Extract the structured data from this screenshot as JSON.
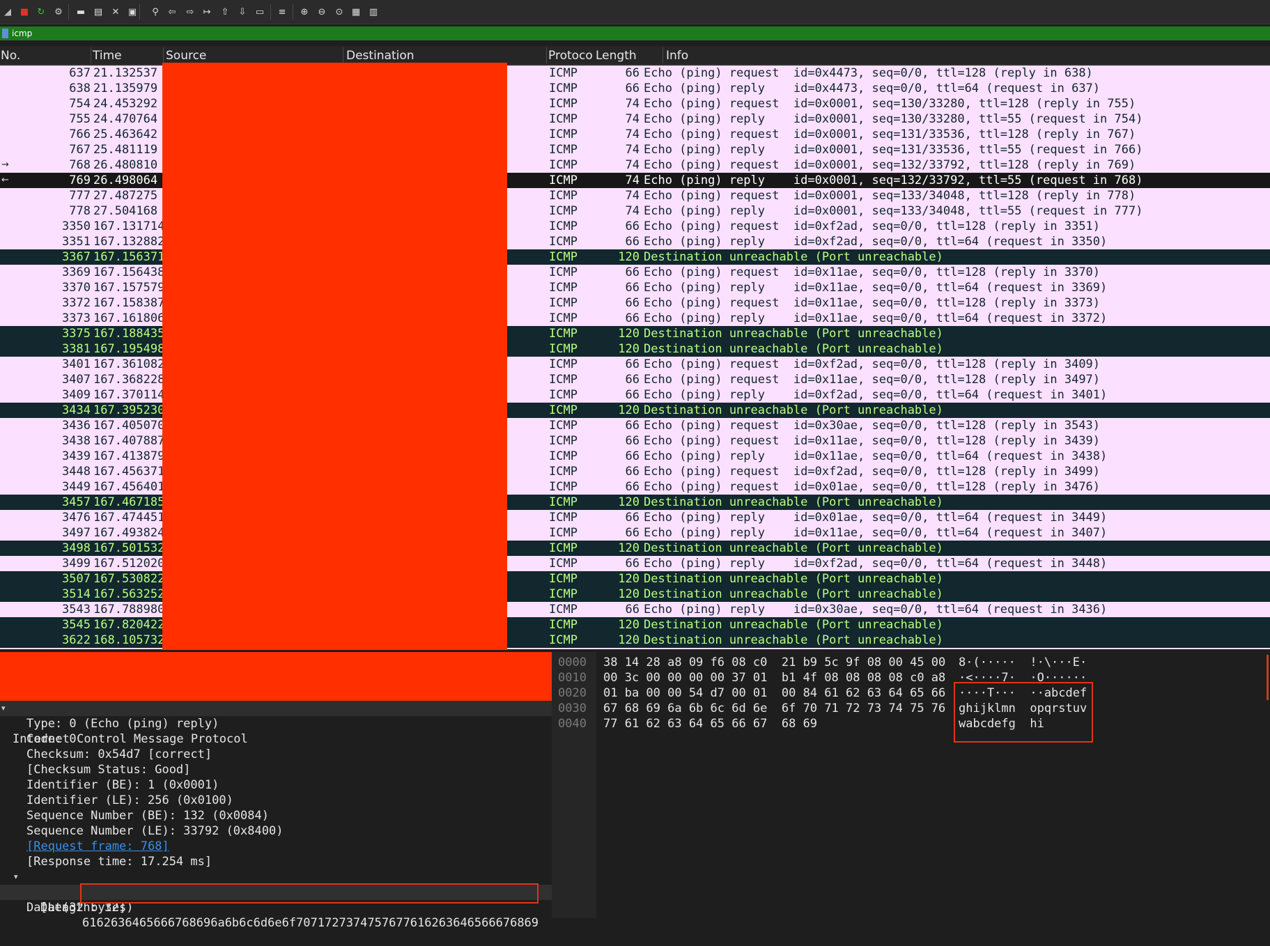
{
  "toolbar": {
    "icons": [
      "shark-fin-icon",
      "stop-capture-icon",
      "restart-capture-icon",
      "capture-options-icon",
      "open-file-icon",
      "save-file-icon",
      "close-file-icon",
      "reload-file-icon",
      "find-packet-icon",
      "go-back-icon",
      "go-forward-icon",
      "go-to-packet-icon",
      "go-first-icon",
      "go-last-icon",
      "autoscroll-icon",
      "colorize-icon",
      "zoom-in-icon",
      "zoom-out-icon",
      "zoom-normal-icon",
      "resize-columns-icon",
      "layout-icon"
    ]
  },
  "filter": {
    "value": "icmp"
  },
  "columns": [
    "No.",
    "Time",
    "Source",
    "Destination",
    "Protoco",
    "Length",
    "Info"
  ],
  "packets": [
    {
      "no": "637",
      "time": "21.132537",
      "proto": "ICMP",
      "len": "66",
      "info": "Echo (ping) request  id=0x4473, seq=0/0, ttl=128 (reply in 638)",
      "kind": "req"
    },
    {
      "no": "638",
      "time": "21.135979",
      "proto": "ICMP",
      "len": "66",
      "info": "Echo (ping) reply    id=0x4473, seq=0/0, ttl=64 (request in 637)",
      "kind": "req"
    },
    {
      "no": "754",
      "time": "24.453292",
      "proto": "ICMP",
      "len": "74",
      "info": "Echo (ping) request  id=0x0001, seq=130/33280, ttl=128 (reply in 755)",
      "kind": "req"
    },
    {
      "no": "755",
      "time": "24.470764",
      "proto": "ICMP",
      "len": "74",
      "info": "Echo (ping) reply    id=0x0001, seq=130/33280, ttl=55 (request in 754)",
      "kind": "req"
    },
    {
      "no": "766",
      "time": "25.463642",
      "proto": "ICMP",
      "len": "74",
      "info": "Echo (ping) request  id=0x0001, seq=131/33536, ttl=128 (reply in 767)",
      "kind": "req"
    },
    {
      "no": "767",
      "time": "25.481119",
      "proto": "ICMP",
      "len": "74",
      "info": "Echo (ping) reply    id=0x0001, seq=131/33536, ttl=55 (request in 766)",
      "kind": "req"
    },
    {
      "no": "768",
      "time": "26.480810",
      "proto": "ICMP",
      "len": "74",
      "info": "Echo (ping) request  id=0x0001, seq=132/33792, ttl=128 (reply in 769)",
      "kind": "req"
    },
    {
      "no": "769",
      "time": "26.498064",
      "proto": "ICMP",
      "len": "74",
      "info": "Echo (ping) reply    id=0x0001, seq=132/33792, ttl=55 (request in 768)",
      "kind": "sel"
    },
    {
      "no": "777",
      "time": "27.487275",
      "proto": "ICMP",
      "len": "74",
      "info": "Echo (ping) request  id=0x0001, seq=133/34048, ttl=128 (reply in 778)",
      "kind": "req"
    },
    {
      "no": "778",
      "time": "27.504168",
      "proto": "ICMP",
      "len": "74",
      "info": "Echo (ping) reply    id=0x0001, seq=133/34048, ttl=55 (request in 777)",
      "kind": "req"
    },
    {
      "no": "3350",
      "time": "167.131714",
      "proto": "ICMP",
      "len": "66",
      "info": "Echo (ping) request  id=0xf2ad, seq=0/0, ttl=128 (reply in 3351)",
      "kind": "req"
    },
    {
      "no": "3351",
      "time": "167.132882",
      "proto": "ICMP",
      "len": "66",
      "info": "Echo (ping) reply    id=0xf2ad, seq=0/0, ttl=64 (request in 3350)",
      "kind": "req"
    },
    {
      "no": "3367",
      "time": "167.156371",
      "proto": "ICMP",
      "len": "120",
      "info": "Destination unreachable (Port unreachable)",
      "kind": "err"
    },
    {
      "no": "3369",
      "time": "167.156438",
      "proto": "ICMP",
      "len": "66",
      "info": "Echo (ping) request  id=0x11ae, seq=0/0, ttl=128 (reply in 3370)",
      "kind": "req"
    },
    {
      "no": "3370",
      "time": "167.157579",
      "proto": "ICMP",
      "len": "66",
      "info": "Echo (ping) reply    id=0x11ae, seq=0/0, ttl=64 (request in 3369)",
      "kind": "req"
    },
    {
      "no": "3372",
      "time": "167.158387",
      "proto": "ICMP",
      "len": "66",
      "info": "Echo (ping) request  id=0x11ae, seq=0/0, ttl=128 (reply in 3373)",
      "kind": "req"
    },
    {
      "no": "3373",
      "time": "167.161806",
      "proto": "ICMP",
      "len": "66",
      "info": "Echo (ping) reply    id=0x11ae, seq=0/0, ttl=64 (request in 3372)",
      "kind": "req"
    },
    {
      "no": "3375",
      "time": "167.188435",
      "proto": "ICMP",
      "len": "120",
      "info": "Destination unreachable (Port unreachable)",
      "kind": "err"
    },
    {
      "no": "3381",
      "time": "167.195498",
      "proto": "ICMP",
      "len": "120",
      "info": "Destination unreachable (Port unreachable)",
      "kind": "err"
    },
    {
      "no": "3401",
      "time": "167.361082",
      "proto": "ICMP",
      "len": "66",
      "info": "Echo (ping) request  id=0xf2ad, seq=0/0, ttl=128 (reply in 3409)",
      "kind": "req"
    },
    {
      "no": "3407",
      "time": "167.368228",
      "proto": "ICMP",
      "len": "66",
      "info": "Echo (ping) request  id=0x11ae, seq=0/0, ttl=128 (reply in 3497)",
      "kind": "req"
    },
    {
      "no": "3409",
      "time": "167.370114",
      "proto": "ICMP",
      "len": "66",
      "info": "Echo (ping) reply    id=0xf2ad, seq=0/0, ttl=64 (request in 3401)",
      "kind": "req"
    },
    {
      "no": "3434",
      "time": "167.395230",
      "proto": "ICMP",
      "len": "120",
      "info": "Destination unreachable (Port unreachable)",
      "kind": "err"
    },
    {
      "no": "3436",
      "time": "167.405070",
      "proto": "ICMP",
      "len": "66",
      "info": "Echo (ping) request  id=0x30ae, seq=0/0, ttl=128 (reply in 3543)",
      "kind": "req"
    },
    {
      "no": "3438",
      "time": "167.407887",
      "proto": "ICMP",
      "len": "66",
      "info": "Echo (ping) request  id=0x11ae, seq=0/0, ttl=128 (reply in 3439)",
      "kind": "req"
    },
    {
      "no": "3439",
      "time": "167.413879",
      "proto": "ICMP",
      "len": "66",
      "info": "Echo (ping) reply    id=0x11ae, seq=0/0, ttl=64 (request in 3438)",
      "kind": "req"
    },
    {
      "no": "3448",
      "time": "167.456371",
      "proto": "ICMP",
      "len": "66",
      "info": "Echo (ping) request  id=0xf2ad, seq=0/0, ttl=128 (reply in 3499)",
      "kind": "req"
    },
    {
      "no": "3449",
      "time": "167.456401",
      "proto": "ICMP",
      "len": "66",
      "info": "Echo (ping) request  id=0x01ae, seq=0/0, ttl=128 (reply in 3476)",
      "kind": "req"
    },
    {
      "no": "3457",
      "time": "167.467185",
      "proto": "ICMP",
      "len": "120",
      "info": "Destination unreachable (Port unreachable)",
      "kind": "err"
    },
    {
      "no": "3476",
      "time": "167.474451",
      "proto": "ICMP",
      "len": "66",
      "info": "Echo (ping) reply    id=0x01ae, seq=0/0, ttl=64 (request in 3449)",
      "kind": "req"
    },
    {
      "no": "3497",
      "time": "167.493824",
      "proto": "ICMP",
      "len": "66",
      "info": "Echo (ping) reply    id=0x11ae, seq=0/0, ttl=64 (request in 3407)",
      "kind": "req"
    },
    {
      "no": "3498",
      "time": "167.501532",
      "proto": "ICMP",
      "len": "120",
      "info": "Destination unreachable (Port unreachable)",
      "kind": "err"
    },
    {
      "no": "3499",
      "time": "167.512020",
      "proto": "ICMP",
      "len": "66",
      "info": "Echo (ping) reply    id=0xf2ad, seq=0/0, ttl=64 (request in 3448)",
      "kind": "req"
    },
    {
      "no": "3507",
      "time": "167.530822",
      "proto": "ICMP",
      "len": "120",
      "info": "Destination unreachable (Port unreachable)",
      "kind": "err"
    },
    {
      "no": "3514",
      "time": "167.563252",
      "proto": "ICMP",
      "len": "120",
      "info": "Destination unreachable (Port unreachable)",
      "kind": "err"
    },
    {
      "no": "3543",
      "time": "167.788980",
      "proto": "ICMP",
      "len": "66",
      "info": "Echo (ping) reply    id=0x30ae, seq=0/0, ttl=64 (request in 3436)",
      "kind": "req"
    },
    {
      "no": "3545",
      "time": "167.820422",
      "proto": "ICMP",
      "len": "120",
      "info": "Destination unreachable (Port unreachable)",
      "kind": "err"
    },
    {
      "no": "3622",
      "time": "168.105732",
      "proto": "ICMP",
      "len": "120",
      "info": "Destination unreachable (Port unreachable)",
      "kind": "err"
    }
  ],
  "details": {
    "protocol": "Internet Control Message Protocol",
    "type": "Type: 0 (Echo (ping) reply)",
    "code": "Code: 0",
    "checksum": "Checksum: 0x54d7 [correct]",
    "checksum_status": "[Checksum Status: Good]",
    "id_be": "Identifier (BE): 1 (0x0001)",
    "id_le": "Identifier (LE): 256 (0x0100)",
    "seq_be": "Sequence Number (BE): 132 (0x0084)",
    "seq_le": "Sequence Number (LE): 33792 (0x8400)",
    "request_frame": "[Request frame: 768]",
    "response_time": "[Response time: 17.254 ms]",
    "data_header": "Data (32 bytes)",
    "data_label": "Data:",
    "data_value": "6162636465666768696a6b6c6d6e6f7071727374757677616263646566676869",
    "length": "[Length: 32]"
  },
  "hex": [
    {
      "off": "0000",
      "bytes": "38 14 28 a8 09 f6 08 c0  21 b9 5c 9f 08 00 45 00",
      "ascii": "8·(·····  !·\\···E·"
    },
    {
      "off": "0010",
      "bytes": "00 3c 00 00 00 00 37 01  b1 4f 08 08 08 08 c0 a8",
      "ascii": "·<····7·  ·O······"
    },
    {
      "off": "0020",
      "bytes": "01 ba 00 00 54 d7 00 01  00 84 61 62 63 64 65 66",
      "ascii": "····T···  ··abcdef"
    },
    {
      "off": "0030",
      "bytes": "67 68 69 6a 6b 6c 6d 6e  6f 70 71 72 73 74 75 76",
      "ascii": "ghijklmn  opqrstuv"
    },
    {
      "off": "0040",
      "bytes": "77 61 62 63 64 65 66 67  68 69",
      "ascii": "wabcdefg  hi"
    }
  ]
}
